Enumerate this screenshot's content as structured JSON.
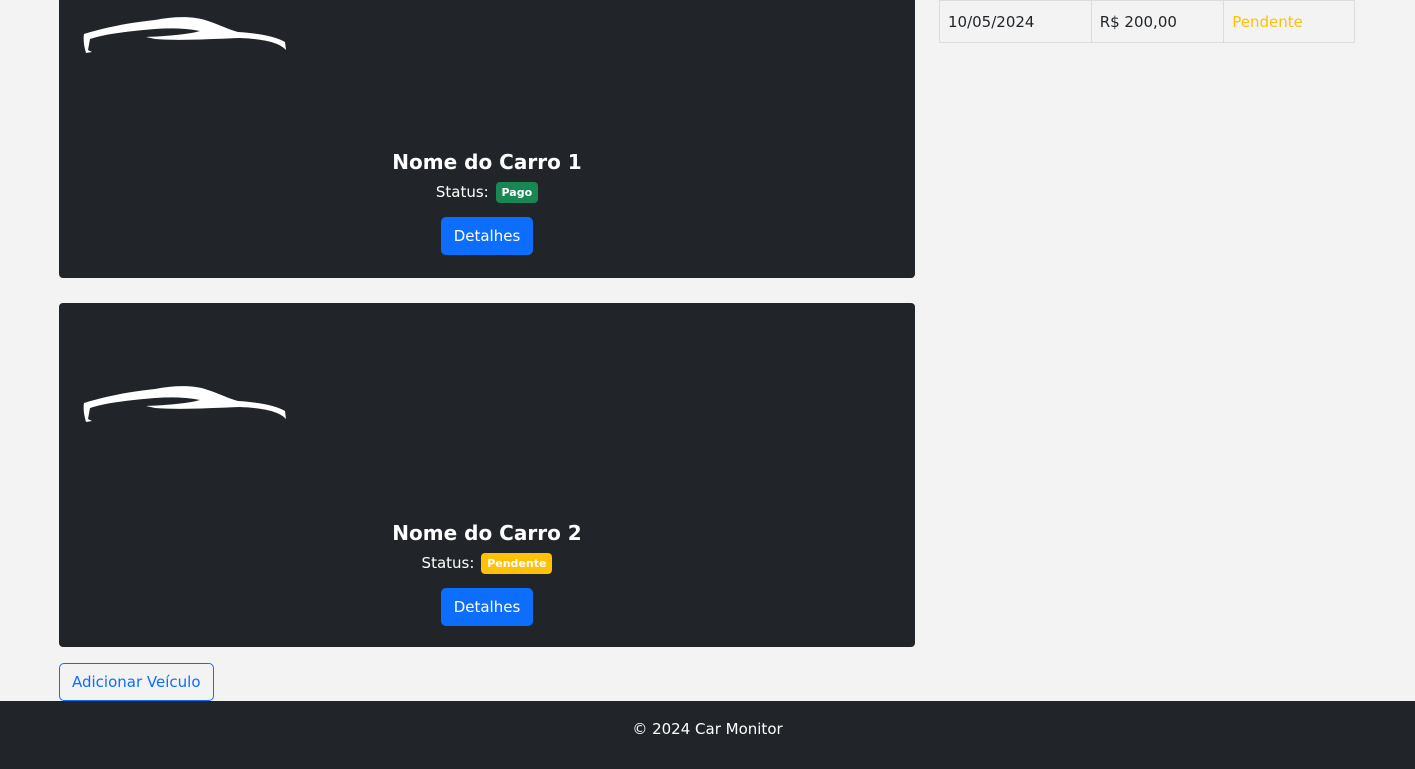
{
  "cars": [
    {
      "name": "Nome do Carro 1",
      "status_label": "Status:",
      "status": "Pago",
      "details_button": "Detalhes"
    },
    {
      "name": "Nome do Carro 2",
      "status_label": "Status:",
      "status": "Pendente",
      "details_button": "Detalhes"
    }
  ],
  "add_vehicle_button": "Adicionar Veículo",
  "payments_table": {
    "rows": [
      {
        "date": "10/05/2024",
        "value": "R$ 200,00",
        "status": "Pendente"
      }
    ]
  },
  "footer": {
    "text": "© 2024 Car Monitor"
  },
  "colors": {
    "card_bg": "#212529",
    "primary": "#0d6efd",
    "success": "#198754",
    "warning": "#ffc107",
    "page_bg": "#f3f3f3"
  },
  "icons": {
    "car_logo": "car-silhouette-icon"
  }
}
